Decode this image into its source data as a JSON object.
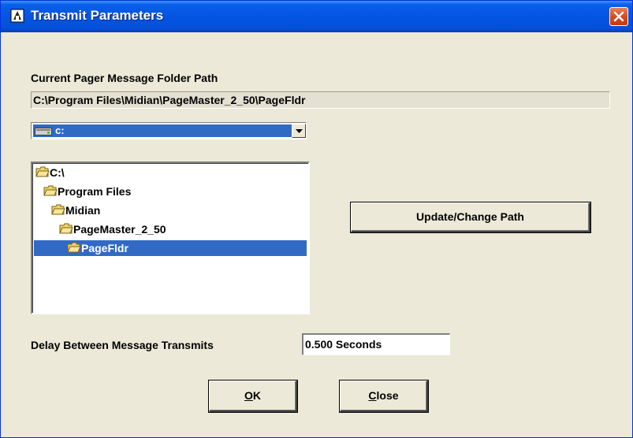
{
  "window": {
    "title": "Transmit Parameters"
  },
  "folder_path": {
    "label": "Current Pager Message Folder Path",
    "value": "C:\\Program Files\\Midian\\PageMaster_2_50\\PageFldr"
  },
  "drive_select": {
    "value": "c:",
    "icon": "drive-icon"
  },
  "folder_tree": {
    "items": [
      {
        "name": "C:\\",
        "level": 0,
        "selected": false
      },
      {
        "name": "Program Files",
        "level": 1,
        "selected": false
      },
      {
        "name": "Midian",
        "level": 2,
        "selected": false
      },
      {
        "name": "PageMaster_2_50",
        "level": 3,
        "selected": false
      },
      {
        "name": "PageFldr",
        "level": 4,
        "selected": true
      }
    ]
  },
  "update_button": {
    "label": "Update/Change Path"
  },
  "delay": {
    "label": "Delay Between Message Transmits",
    "value": "0.500 Seconds"
  },
  "ok_button": {
    "accel": "O",
    "rest": "K"
  },
  "close_button": {
    "accel": "C",
    "rest": "lose"
  },
  "colors": {
    "titlebar": "#0554e3",
    "selection": "#316ac5",
    "dialog_bg": "#ece9d8",
    "close_button": "#d94a1d"
  }
}
